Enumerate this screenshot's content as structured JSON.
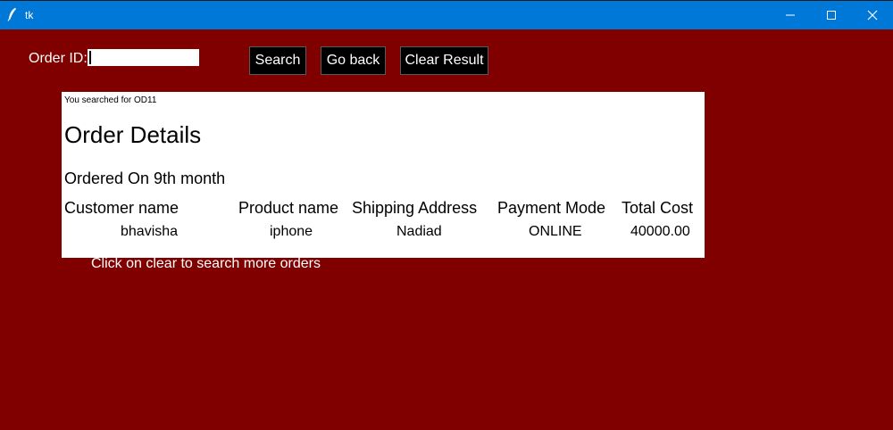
{
  "window": {
    "title": "tk",
    "background": "#800000",
    "titlebar_color": "#0078d7"
  },
  "form": {
    "order_label": "Order ID:",
    "order_value": "",
    "search_label": "Search",
    "back_label": "Go back",
    "clear_label": "Clear Result"
  },
  "result": {
    "searched_for": "You searched for OD11",
    "heading": "Order Details",
    "ordered_on": "Ordered On 9th month",
    "columns": [
      "Customer name",
      "Product name",
      "Shipping Address",
      "Payment Mode",
      "Total Cost"
    ],
    "row": [
      "bhavisha",
      "iphone",
      "Nadiad",
      "ONLINE",
      "40000.00"
    ]
  },
  "hint": "Click on clear to search more orders"
}
